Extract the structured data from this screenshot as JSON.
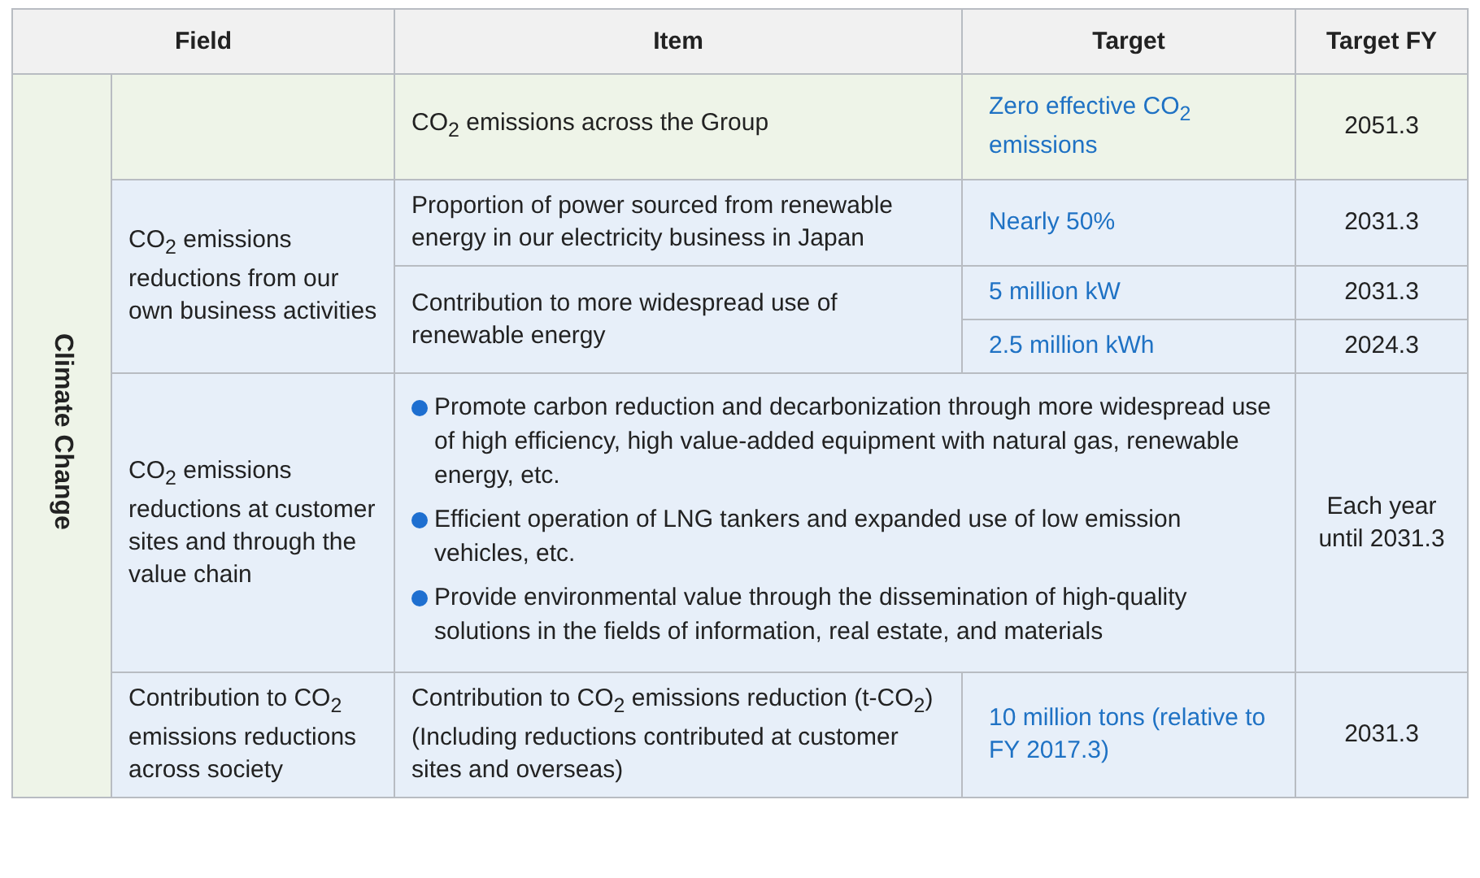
{
  "header": {
    "field": "Field",
    "item": "Item",
    "target": "Target",
    "target_fy": "Target FY"
  },
  "field": "Climate Change",
  "groups": [
    {
      "kind": "total",
      "rows": [
        {
          "item": [
            "CO$_{2}$ emissions across the Group"
          ],
          "targets": [
            {
              "text": "Zero effective CO$_{2}$ emissions",
              "fy": "2051.3"
            }
          ]
        }
      ]
    },
    {
      "kind": "sub",
      "subfield": "CO$_{2}$ emissions reductions from our own business activities",
      "rows": [
        {
          "item": [
            "Proportion of power sourced from renewable energy in our electricity business in Japan"
          ],
          "targets": [
            {
              "text": "Nearly 50%",
              "fy": "2031.3"
            }
          ]
        },
        {
          "item": [
            "Contribution to more widespread use of renewable energy"
          ],
          "targets": [
            {
              "text": "5 million kW",
              "fy": "2031.3"
            },
            {
              "text": "2.5 million kWh",
              "fy": "2024.3"
            }
          ]
        }
      ]
    },
    {
      "kind": "sub",
      "subfield": "CO$_{2}$ emissions reductions at customer sites and through the value chain",
      "rows": [
        {
          "bullets": [
            "Promote carbon reduction and decarbonization through more widespread use of high efficiency, high value-added equipment with natural gas, renewable energy, etc.",
            "Efficient operation of LNG tankers and expanded use of low emission vehicles, etc.",
            "Provide environmental value through the dissemination of high-quality solutions in the fields of information, real estate, and materials"
          ],
          "fy": "Each year until 2031.3"
        }
      ]
    },
    {
      "kind": "sub",
      "subfield": "Contribution to CO$_{2}$ emissions reductions across society",
      "rows": [
        {
          "item": [
            "Contribution to CO$_{2}$ emissions reduction (t-CO$_{2}$)",
            "(Including reductions contributed at customer sites and overseas)"
          ],
          "targets": [
            {
              "text": "10 million tons (relative to FY 2017.3)",
              "fy": "2031.3"
            }
          ]
        }
      ]
    }
  ]
}
